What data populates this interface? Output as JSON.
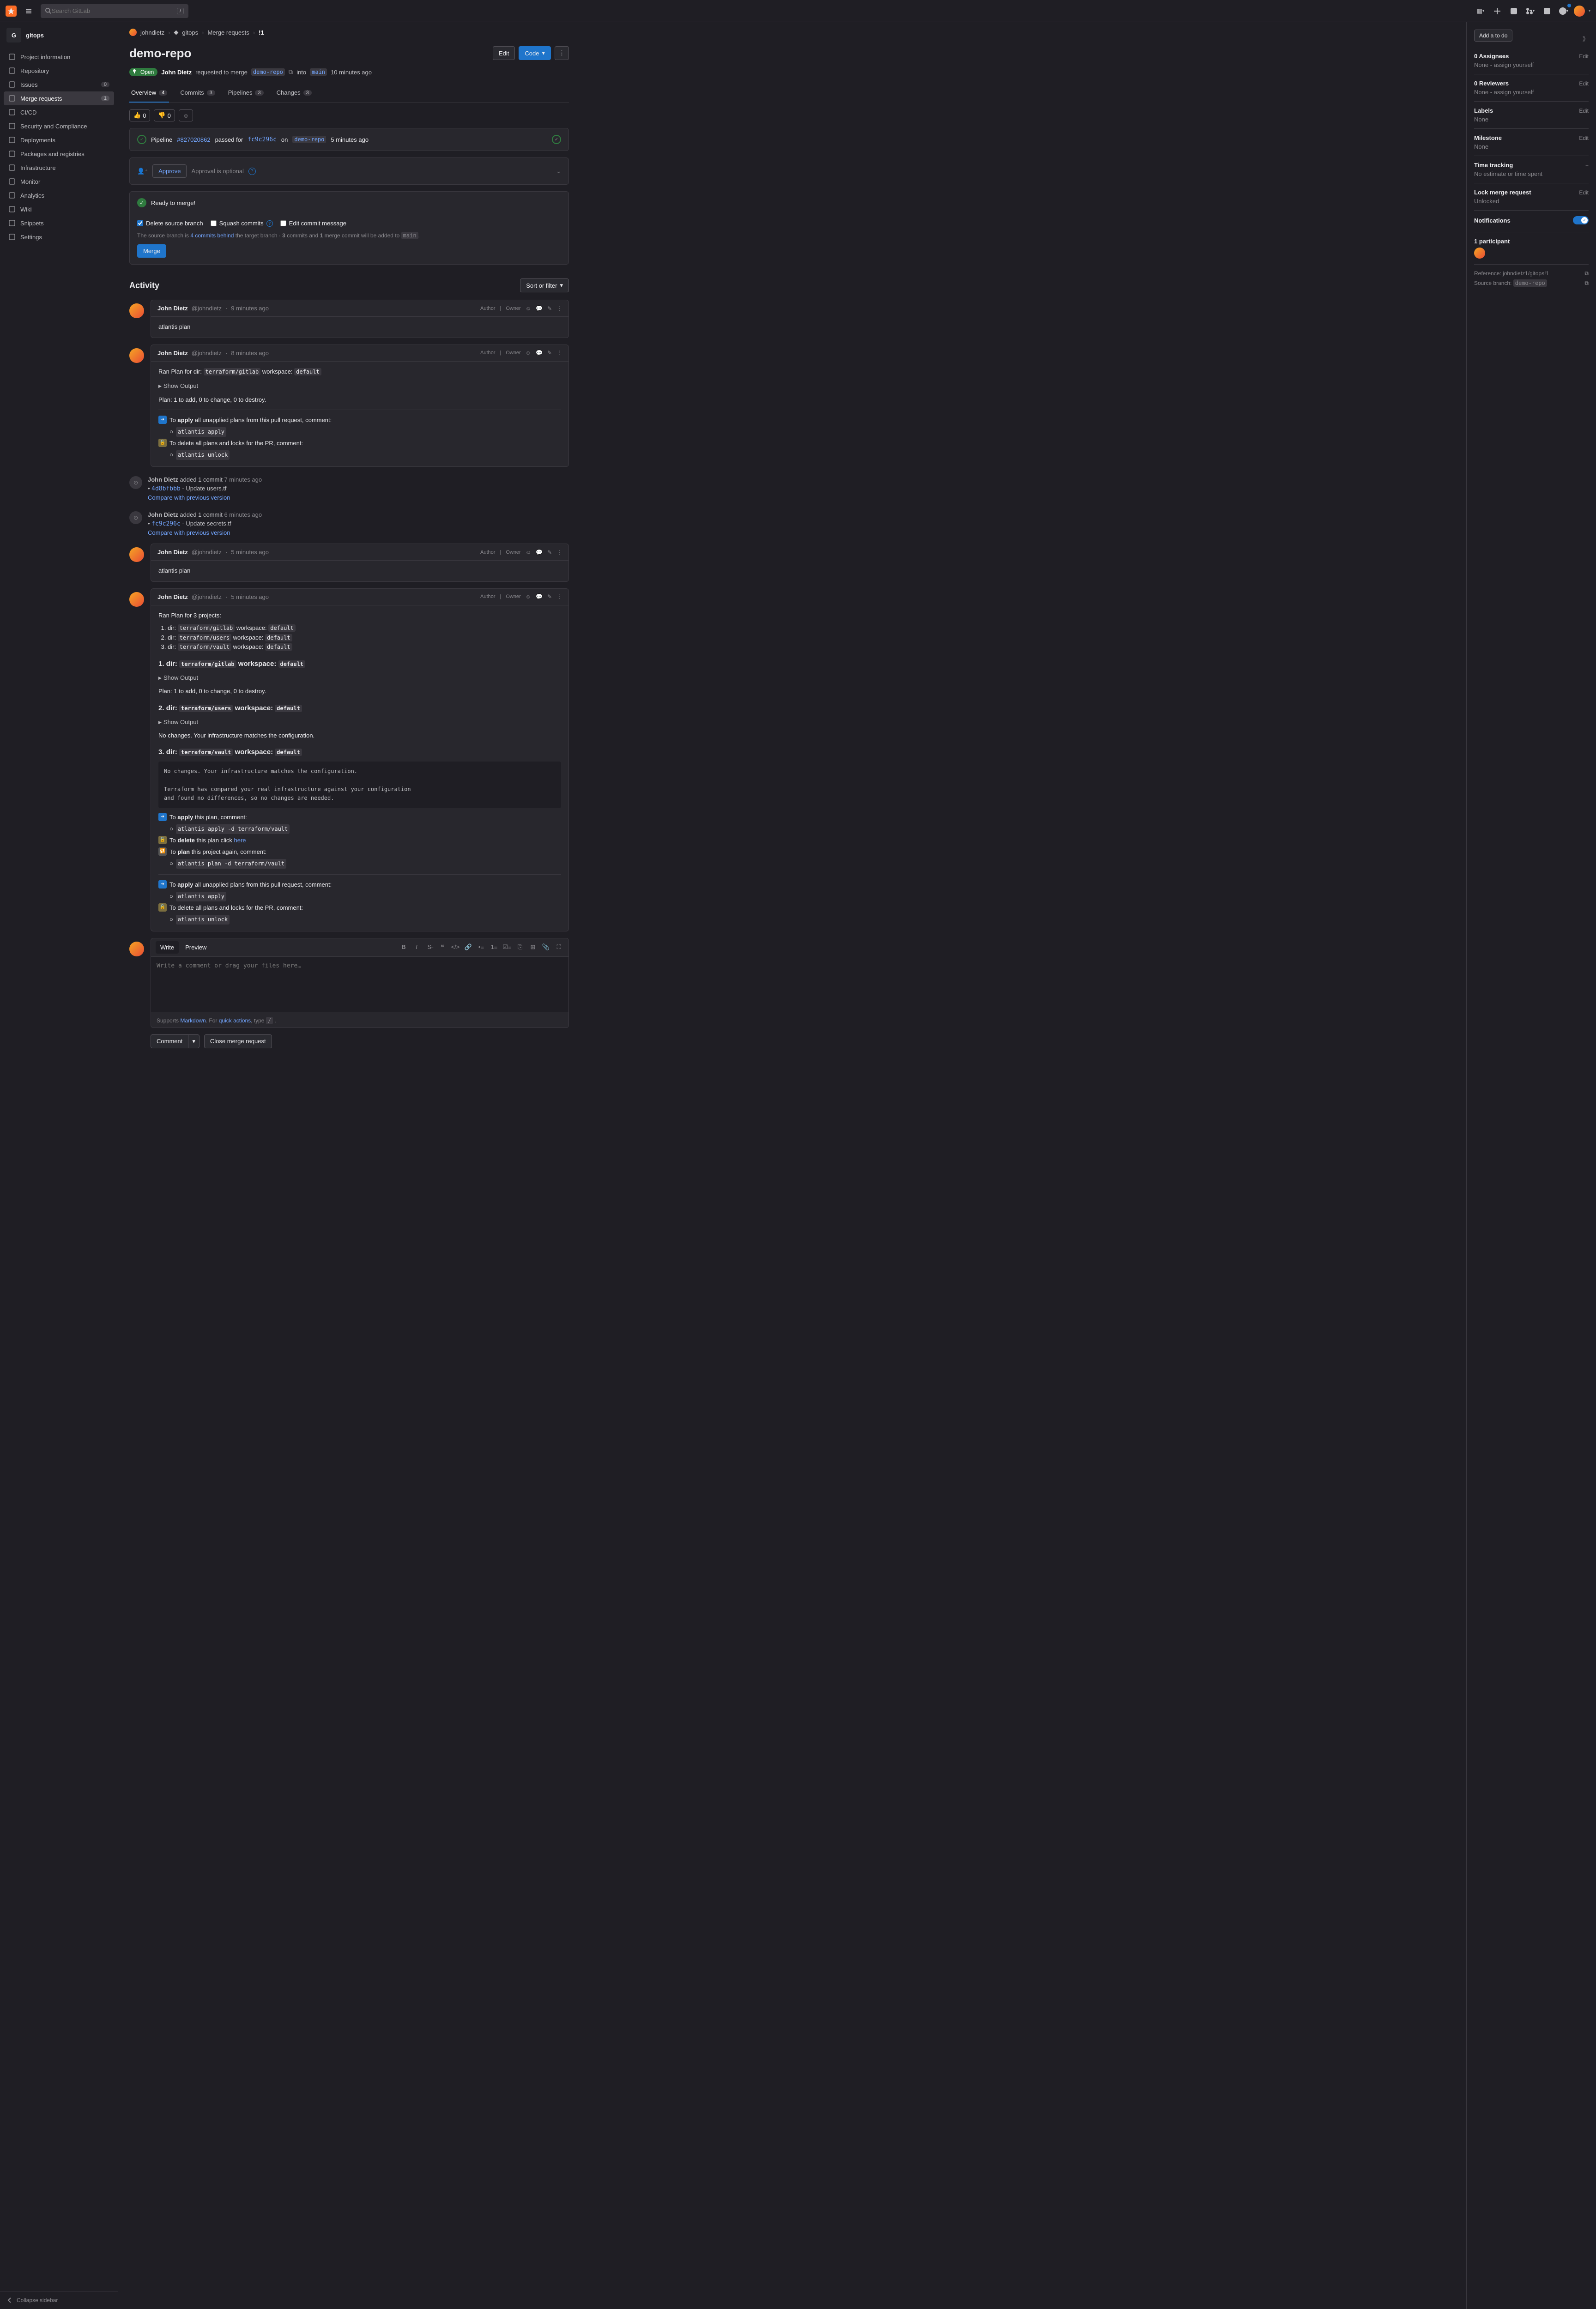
{
  "search": {
    "placeholder": "Search GitLab",
    "kbd": "/"
  },
  "project": {
    "name": "gitops",
    "initial": "G"
  },
  "nav": [
    {
      "label": "Project information",
      "icon": "info"
    },
    {
      "label": "Repository",
      "icon": "repo"
    },
    {
      "label": "Issues",
      "icon": "issues",
      "count": "0"
    },
    {
      "label": "Merge requests",
      "icon": "mr",
      "count": "1",
      "active": true
    },
    {
      "label": "CI/CD",
      "icon": "cicd"
    },
    {
      "label": "Security and Compliance",
      "icon": "shield"
    },
    {
      "label": "Deployments",
      "icon": "deploy"
    },
    {
      "label": "Packages and registries",
      "icon": "package"
    },
    {
      "label": "Infrastructure",
      "icon": "infra"
    },
    {
      "label": "Monitor",
      "icon": "monitor"
    },
    {
      "label": "Analytics",
      "icon": "analytics"
    },
    {
      "label": "Wiki",
      "icon": "wiki"
    },
    {
      "label": "Snippets",
      "icon": "snippets"
    },
    {
      "label": "Settings",
      "icon": "settings"
    }
  ],
  "collapse": "Collapse sidebar",
  "crumbs": {
    "user": "johndietz",
    "project": "gitops",
    "section": "Merge requests",
    "id": "!1"
  },
  "mr": {
    "title": "demo-repo",
    "edit": "Edit",
    "code": "Code",
    "status": "Open",
    "author": "John Dietz",
    "requested": "requested to merge",
    "source": "demo-repo",
    "into": "into",
    "target": "main",
    "time": "10 minutes ago"
  },
  "tabs": [
    {
      "label": "Overview",
      "count": "4",
      "active": true
    },
    {
      "label": "Commits",
      "count": "3"
    },
    {
      "label": "Pipelines",
      "count": "3"
    },
    {
      "label": "Changes",
      "count": "3"
    }
  ],
  "reactions": {
    "up": "0",
    "down": "0"
  },
  "pipeline": {
    "prefix": "Pipeline",
    "id": "#827020862",
    "passed": "passed for",
    "sha": "fc9c296c",
    "on": "on",
    "branch": "demo-repo",
    "time": "5 minutes ago"
  },
  "approval": {
    "approve": "Approve",
    "optional": "Approval is optional"
  },
  "merge": {
    "ready": "Ready to merge!",
    "delete_src": "Delete source branch",
    "squash": "Squash commits",
    "edit_msg": "Edit commit message",
    "help": "The source branch is 4 commits behind the target branch · 3 commits and 1 merge commit will be added to main.",
    "help_link": "4 commits behind",
    "btn": "Merge"
  },
  "activity": {
    "title": "Activity",
    "sort": "Sort or filter"
  },
  "notes": [
    {
      "name": "John Dietz",
      "user": "@johndietz",
      "time": "9 minutes ago",
      "author": "Author",
      "owner": "Owner",
      "body": "atlantis plan"
    },
    {
      "name": "John Dietz",
      "user": "@johndietz",
      "time": "8 minutes ago",
      "author": "Author",
      "owner": "Owner",
      "ran": "Ran Plan for dir:",
      "dir": "terraform/gitlab",
      "ws": "workspace:",
      "wsv": "default",
      "show": "Show Output",
      "plan_summary": "Plan: 1 to add, 0 to change, 0 to destroy.",
      "apply_pre": "To ",
      "apply_b": "apply",
      "apply_post": " all unapplied plans from this pull request, comment:",
      "apply_cmd": "atlantis apply",
      "del_pre": "To delete all plans and locks for the PR, comment:",
      "del_cmd": "atlantis unlock"
    }
  ],
  "sys": [
    {
      "name": "John Dietz",
      "text": "added 1 commit",
      "time": "7 minutes ago",
      "sha": "4d8bfbbb",
      "msg": "Update users.tf",
      "compare": "Compare with previous version"
    },
    {
      "name": "John Dietz",
      "text": "added 1 commit",
      "time": "6 minutes ago",
      "sha": "fc9c296c",
      "msg": "Update secrets.tf",
      "compare": "Compare with previous version"
    }
  ],
  "note3": {
    "name": "John Dietz",
    "user": "@johndietz",
    "time": "5 minutes ago",
    "author": "Author",
    "owner": "Owner",
    "body": "atlantis plan"
  },
  "note4": {
    "name": "John Dietz",
    "user": "@johndietz",
    "time": "5 minutes ago",
    "author": "Author",
    "owner": "Owner",
    "ran": "Ran Plan for 3 projects:",
    "projects": [
      {
        "dir": "terraform/gitlab",
        "ws": "default"
      },
      {
        "dir": "terraform/users",
        "ws": "default"
      },
      {
        "dir": "terraform/vault",
        "ws": "default"
      }
    ],
    "sections": [
      {
        "n": "1.",
        "dir": "terraform/gitlab",
        "ws": "default",
        "show": "Show Output",
        "summary": "Plan: 1 to add, 0 to change, 0 to destroy."
      },
      {
        "n": "2.",
        "dir": "terraform/users",
        "ws": "default",
        "show": "Show Output",
        "summary": "No changes. Your infrastructure matches the configuration."
      },
      {
        "n": "3.",
        "dir": "terraform/vault",
        "ws": "default"
      }
    ],
    "vault_pre": "No changes. Your infrastructure matches the configuration.\n\nTerraform has compared your real infrastructure against your configuration\nand found no differences, so no changes are needed.",
    "apply_plan": "this plan, comment:",
    "apply_cmd_d": "atlantis apply -d terraform/vault",
    "delete_plan": "this plan click",
    "here": "here",
    "plan_again": "this project again, comment:",
    "plan_cmd_d": "atlantis plan -d terraform/vault",
    "apply_all": "all unapplied plans from this pull request, comment:",
    "apply_cmd": "atlantis apply",
    "del_all": "To delete all plans and locks for the PR, comment:",
    "unlock_cmd": "atlantis unlock",
    "dir_label": "dir:",
    "ws_label": "workspace:",
    "to": "To ",
    "apply": "apply",
    "delete": "delete",
    "plan": "plan"
  },
  "editor": {
    "write": "Write",
    "preview": "Preview",
    "placeholder": "Write a comment or drag your files here…",
    "supports": "Supports ",
    "md": "Markdown",
    ". For ": "",
    "qa": "quick actions",
    ", type ": "",
    "slash": "/"
  },
  "footbtn": {
    "comment": "Comment",
    "close": "Close merge request"
  },
  "rside": {
    "add_todo": "Add a to do",
    "assignees": {
      "lbl": "0 Assignees",
      "val": "None - assign yourself",
      "edit": "Edit"
    },
    "reviewers": {
      "lbl": "0 Reviewers",
      "val": "None - assign yourself",
      "edit": "Edit"
    },
    "labels": {
      "lbl": "Labels",
      "val": "None",
      "edit": "Edit"
    },
    "milestone": {
      "lbl": "Milestone",
      "val": "None",
      "edit": "Edit"
    },
    "time": {
      "lbl": "Time tracking",
      "val": "No estimate or time spent"
    },
    "lock": {
      "lbl": "Lock merge request",
      "val": "Unlocked",
      "edit": "Edit"
    },
    "notif": "Notifications",
    "part": "1 participant",
    "ref": "Reference: johndietz1/gitops!1",
    "src": "Source branch: ",
    "src_code": "demo-repo"
  }
}
